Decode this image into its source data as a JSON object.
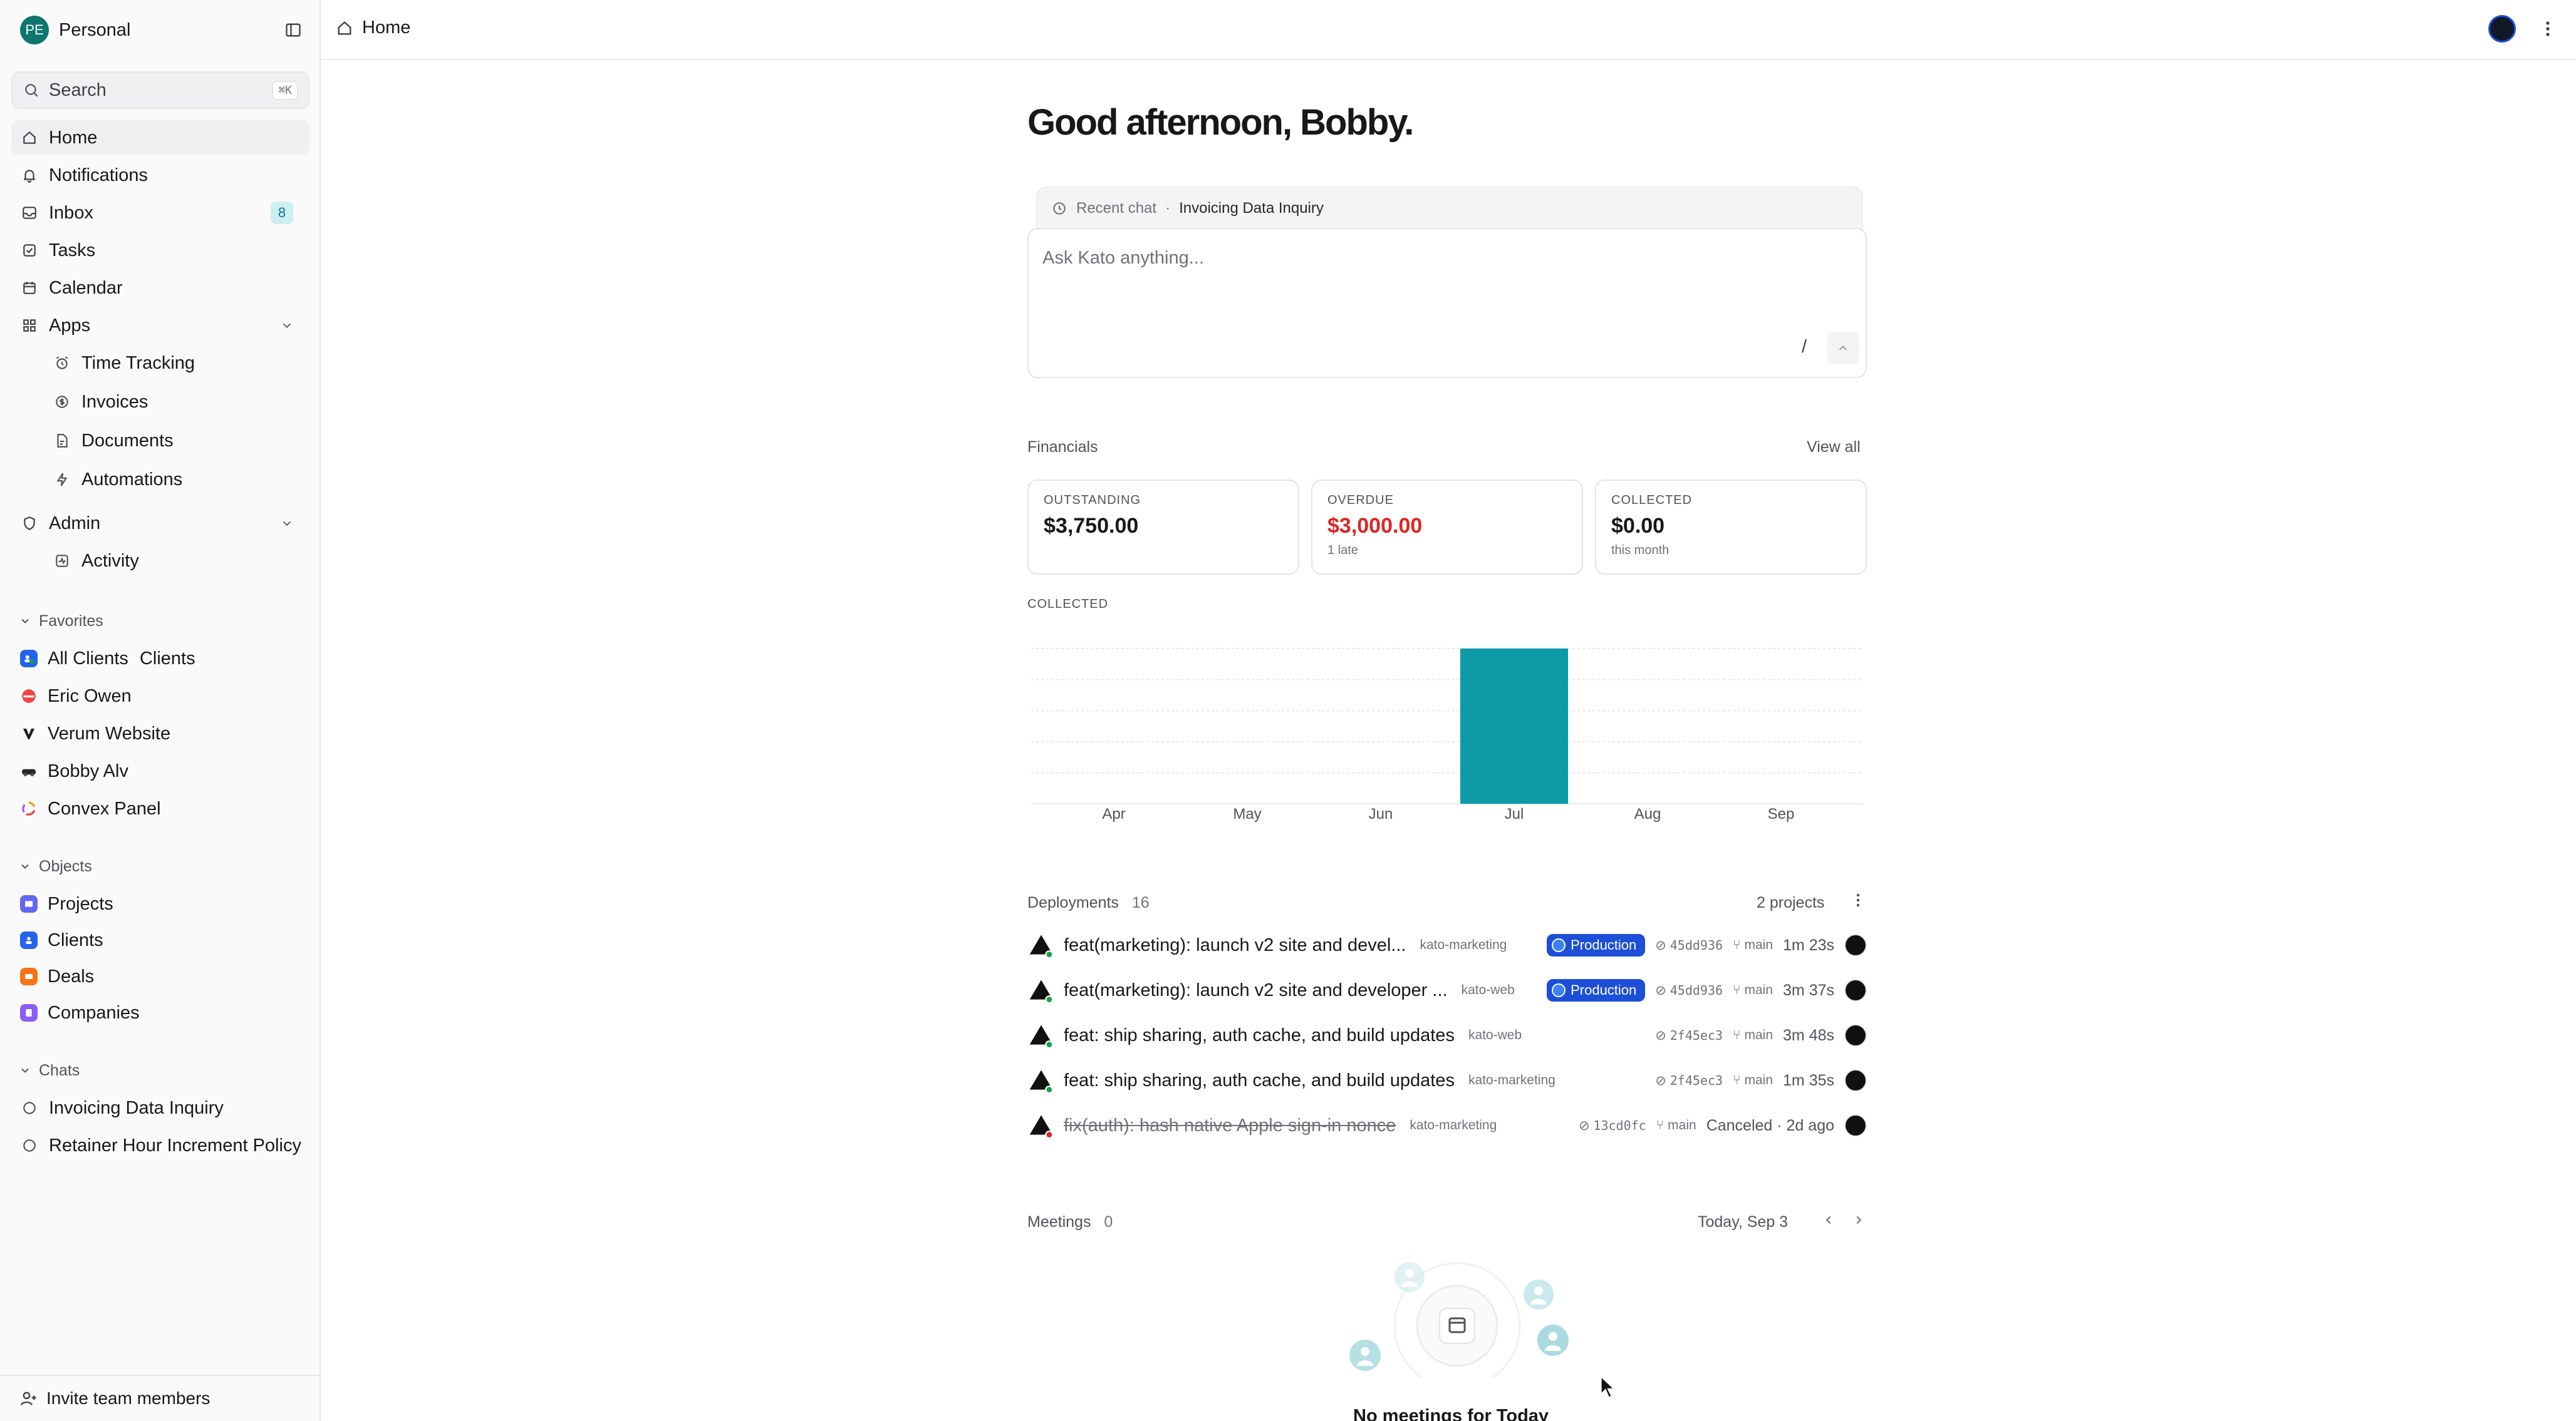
{
  "workspace": {
    "initials": "PE",
    "name": "Personal"
  },
  "search": {
    "label": "Search",
    "shortcut": "⌘K"
  },
  "nav": {
    "home": "Home",
    "notifications": "Notifications",
    "inbox": "Inbox",
    "inbox_count": "8",
    "tasks": "Tasks",
    "calendar": "Calendar",
    "apps": "Apps",
    "apps_items": [
      "Time Tracking",
      "Invoices",
      "Documents",
      "Automations"
    ],
    "admin": "Admin",
    "admin_items": [
      "Activity"
    ]
  },
  "favorites": {
    "title": "Favorites",
    "items": [
      {
        "label": "All Clients",
        "suffix": "Clients"
      },
      {
        "label": "Eric Owen"
      },
      {
        "label": "Verum Website"
      },
      {
        "label": "Bobby Alv"
      },
      {
        "label": "Convex Panel"
      }
    ]
  },
  "objects": {
    "title": "Objects",
    "items": [
      "Projects",
      "Clients",
      "Deals",
      "Companies"
    ]
  },
  "chats": {
    "title": "Chats",
    "items": [
      "Invoicing Data Inquiry",
      "Retainer Hour Increment Policy"
    ]
  },
  "invite": "Invite team members",
  "header": {
    "breadcrumb": "Home"
  },
  "greeting": "Good afternoon, Bobby.",
  "recent_chat": {
    "label": "Recent chat",
    "sep": "·",
    "title": "Invoicing Data Inquiry"
  },
  "ask": {
    "placeholder": "Ask Kato anything...",
    "slash": "/"
  },
  "financials": {
    "title": "Financials",
    "view_all": "View all",
    "cards": [
      {
        "label": "OUTSTANDING",
        "value": "$3,750.00",
        "sub": ""
      },
      {
        "label": "OVERDUE",
        "value": "$3,000.00",
        "sub": "1 late"
      },
      {
        "label": "COLLECTED",
        "value": "$0.00",
        "sub": "this month"
      }
    ],
    "chart_label": "COLLECTED"
  },
  "chart_data": {
    "type": "bar",
    "categories": [
      "Apr",
      "May",
      "Jun",
      "Jul",
      "Aug",
      "Sep"
    ],
    "values": [
      0,
      0,
      0,
      1,
      0,
      0
    ],
    "ylim": [
      0,
      1
    ],
    "grid": true,
    "bar_color": "#0e9aa7"
  },
  "deployments": {
    "title": "Deployments",
    "count": "16",
    "projects": "2 projects",
    "rows": [
      {
        "title": "feat(marketing): launch v2 site and devel...",
        "project": "kato-marketing",
        "env": "Production",
        "commit": "45dd936",
        "branch": "main",
        "duration": "1m 23s",
        "status": "ok",
        "canceled": false
      },
      {
        "title": "feat(marketing): launch v2 site and developer ...",
        "project": "kato-web",
        "env": "Production",
        "commit": "45dd936",
        "branch": "main",
        "duration": "3m 37s",
        "status": "ok",
        "canceled": false
      },
      {
        "title": "feat: ship sharing, auth cache, and build updates",
        "project": "kato-web",
        "env": "",
        "commit": "2f45ec3",
        "branch": "main",
        "duration": "3m 48s",
        "status": "ok",
        "canceled": false
      },
      {
        "title": "feat: ship sharing, auth cache, and build updates",
        "project": "kato-marketing",
        "env": "",
        "commit": "2f45ec3",
        "branch": "main",
        "duration": "1m 35s",
        "status": "ok",
        "canceled": false
      },
      {
        "title": "fix(auth): hash native Apple sign-in nonce",
        "project": "kato-marketing",
        "env": "",
        "commit": "13cd0fc",
        "branch": "main",
        "duration": "Canceled · 2d ago",
        "status": "error",
        "canceled": true
      }
    ]
  },
  "meetings": {
    "title": "Meetings",
    "count": "0",
    "date": "Today, Sep 3",
    "empty": "No meetings for Today"
  },
  "colors": {
    "accent": "#0e9aa7",
    "production": "#1d4ed8",
    "danger": "#dc2626",
    "success": "#16a34a"
  }
}
